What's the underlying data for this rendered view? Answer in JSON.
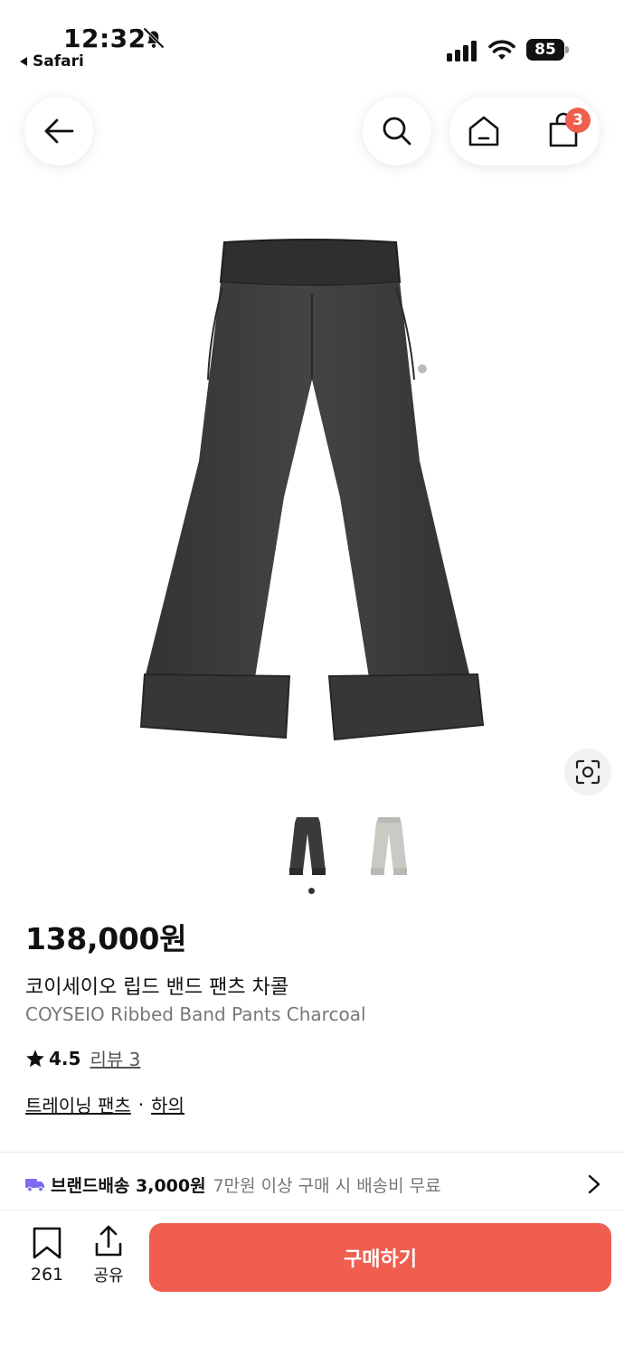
{
  "status_bar": {
    "time": "12:32",
    "back_app": "Safari",
    "battery": "85"
  },
  "header": {
    "cart_count": "3"
  },
  "product": {
    "price": "138,000원",
    "name_ko": "코이세이오 립드 밴드 팬츠 차콜",
    "name_en": "COYSEIO Ribbed Band Pants Charcoal",
    "rating": "4.5",
    "review_label": "리뷰 3",
    "category_1": "트레이닝 팬츠",
    "separator": "·",
    "category_2": "하의",
    "colors": {
      "charcoal": "#3a3a3a",
      "light": "#c9cac3"
    }
  },
  "shipping": {
    "label": "브랜드배송 3,000원",
    "note": "7만원 이상 구매 시 배송비 무료"
  },
  "bottom_bar": {
    "wish_count": "261",
    "share_label": "공유",
    "buy_label": "구매하기",
    "accent": "#ef5e4e"
  }
}
